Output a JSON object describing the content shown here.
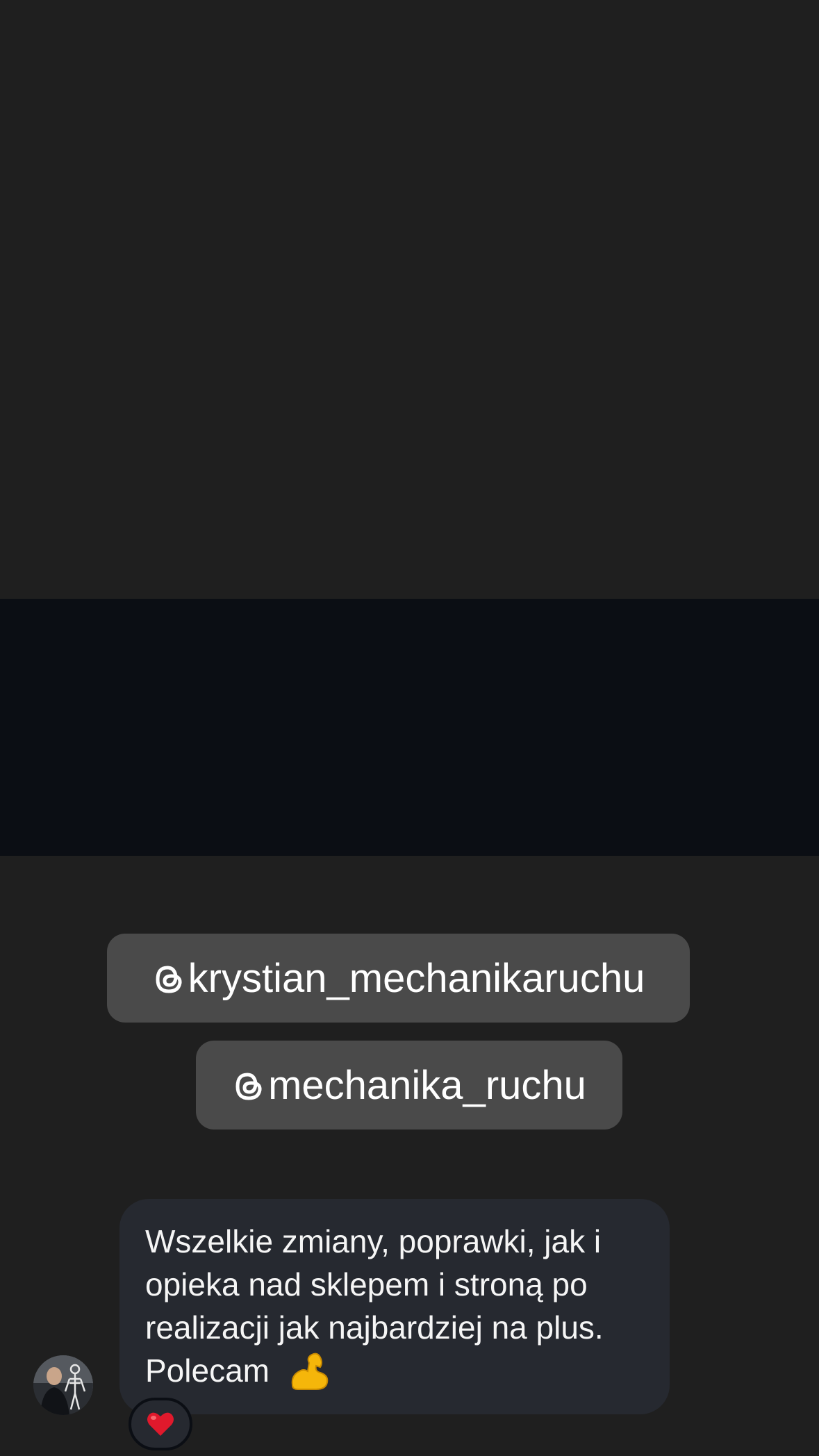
{
  "message": {
    "lines": [
      "Wszelkie zmiany, poprawki, jak i",
      "opieka nad sklepem i stroną po",
      "realizacji jak najbardziej na plus.",
      "Polecam"
    ],
    "emoji": "💪",
    "reaction": "❤️"
  },
  "mentions": [
    {
      "icon": "threads-icon",
      "handle": "krystian_mechanikaruchu"
    },
    {
      "icon": "threads-icon",
      "handle": "mechanika_ruchu"
    }
  ],
  "colors": {
    "background": "#1f1f1f",
    "message_band": "#0b0e14",
    "bubble": "#262930",
    "mention_pill": "#4a4a4a",
    "text": "#ffffff",
    "heart": "#e0192c",
    "emoji_arm": "#f5b60a"
  }
}
